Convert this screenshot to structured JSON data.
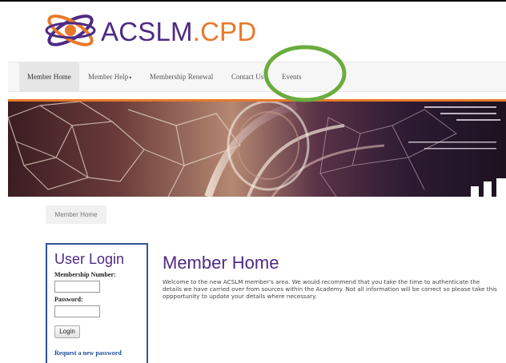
{
  "logo": {
    "text_primary": "ACSLM",
    "text_dot": ".",
    "text_secondary": "CPD",
    "icon": "atom-icon"
  },
  "nav": {
    "items": [
      {
        "label": "Member Home",
        "active": true
      },
      {
        "label": "Member Help",
        "has_dropdown": true,
        "caret": "▾"
      },
      {
        "label": "Membership Renewal"
      },
      {
        "label": "Contact Us"
      },
      {
        "label": "Events"
      }
    ]
  },
  "breadcrumb": {
    "current": "Member Home"
  },
  "login": {
    "title": "User Login",
    "membership_label": "Membership Number:",
    "membership_value": "",
    "password_label": "Password:",
    "password_value": "",
    "button_label": "Login",
    "link_label": "Request a new password"
  },
  "main": {
    "title": "Member Home",
    "text": "Welcome to the new ACSLM member's area. We would recommend that you take the time to authenticate the details we have carried over from sources within the Academy. Not all information will be correct so please take this oppportunity to update your details where necessary."
  },
  "colors": {
    "brand_purple": "#4e2a84",
    "brand_orange": "#e8792a",
    "login_border": "#2f5597",
    "annotation_green": "#6aac3e"
  }
}
